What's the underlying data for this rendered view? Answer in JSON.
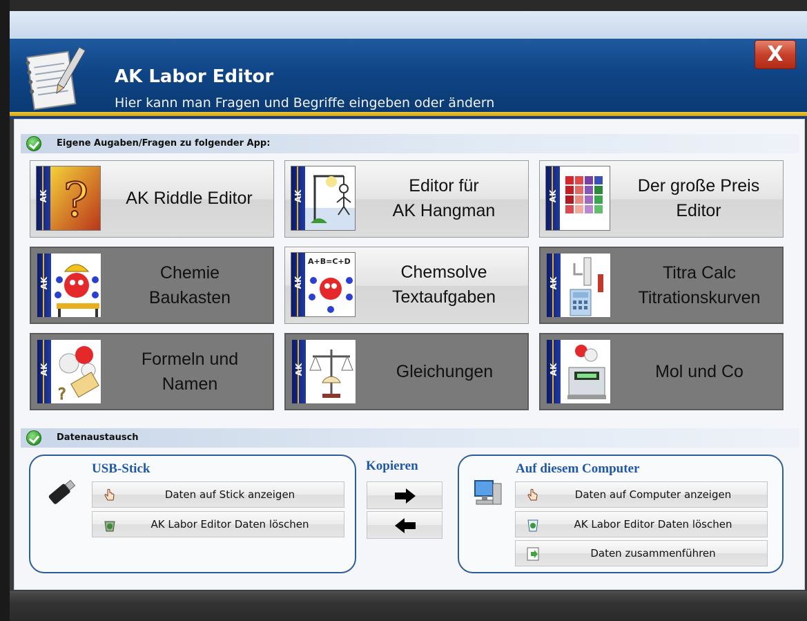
{
  "header": {
    "title": "AK Labor Editor",
    "subtitle": "Hier kann man Fragen und Begriffe eingeben oder ändern",
    "close_label": "X"
  },
  "section_apps": {
    "label": "Eigene Augaben/Fragen zu folgender App:",
    "tiles": [
      {
        "label": "AK Riddle Editor",
        "icon": "riddle-question-icon",
        "style": "light"
      },
      {
        "label": "Editor für\nAK Hangman",
        "icon": "hangman-icon",
        "style": "light"
      },
      {
        "label": "Der große Preis\nEditor",
        "icon": "color-grid-icon",
        "style": "light"
      },
      {
        "label": "Chemie\nBaukasten",
        "icon": "molecule-builder-icon",
        "style": "dark"
      },
      {
        "label": "Chemsolve\nTextaufgaben",
        "icon": "equation-molecule-icon",
        "style": "light"
      },
      {
        "label": "Titra Calc\nTitrationskurven",
        "icon": "titration-icon",
        "style": "dark"
      },
      {
        "label": "Formeln und\nNamen",
        "icon": "molecule-tag-icon",
        "style": "dark"
      },
      {
        "label": "Gleichungen",
        "icon": "balance-scale-icon",
        "style": "dark"
      },
      {
        "label": "Mol und Co",
        "icon": "lab-scale-icon",
        "style": "dark"
      }
    ],
    "ak_text": "AK"
  },
  "section_exchange": {
    "label": "Datenaustausch",
    "usb": {
      "title": "USB-Stick",
      "show_label": "Daten auf Stick anzeigen",
      "delete_label": "AK Labor Editor Daten löschen"
    },
    "copy": {
      "title": "Kopieren"
    },
    "computer": {
      "title": "Auf diesem Computer",
      "show_label": "Daten auf Computer anzeigen",
      "delete_label": "AK Labor Editor Daten löschen",
      "merge_label": "Daten zusammenführen"
    }
  }
}
